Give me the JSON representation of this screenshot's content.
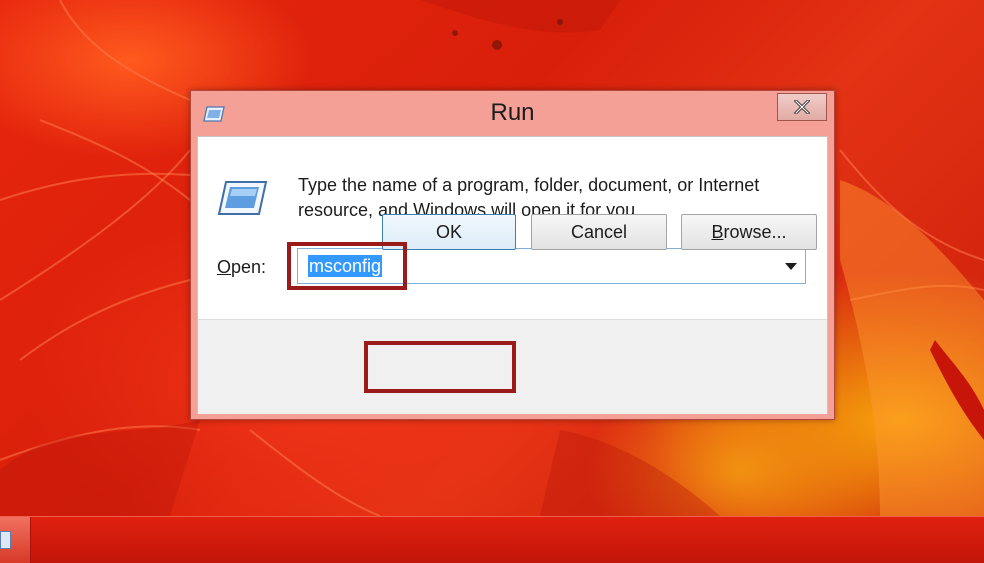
{
  "desktop": {
    "wallpaper": "red autumn leaves",
    "taskbar": {
      "start_icon": "run-icon"
    }
  },
  "dialog": {
    "title": "Run",
    "title_icon": "run-icon",
    "close_icon": "close-icon",
    "description": "Type the name of a program, folder, document, or Internet resource, and Windows will open it for you.",
    "open_label": "Open:",
    "open_label_mnemonic": "O",
    "open_label_rest": "pen:",
    "command_value": "msconfig",
    "dropdown_icon": "chevron-down-icon",
    "buttons": {
      "ok": "OK",
      "cancel": "Cancel",
      "browse": "Browse...",
      "browse_mnemonic": "B",
      "browse_rest": "rowse..."
    }
  },
  "annotations": {
    "highlight_color": "#9b1a1a",
    "highlighted": [
      "command-input",
      "ok-button"
    ]
  },
  "colors": {
    "titlebar": "#f4a097",
    "selection": "#3399ff",
    "ok_focus_border": "#3c7fb1"
  }
}
